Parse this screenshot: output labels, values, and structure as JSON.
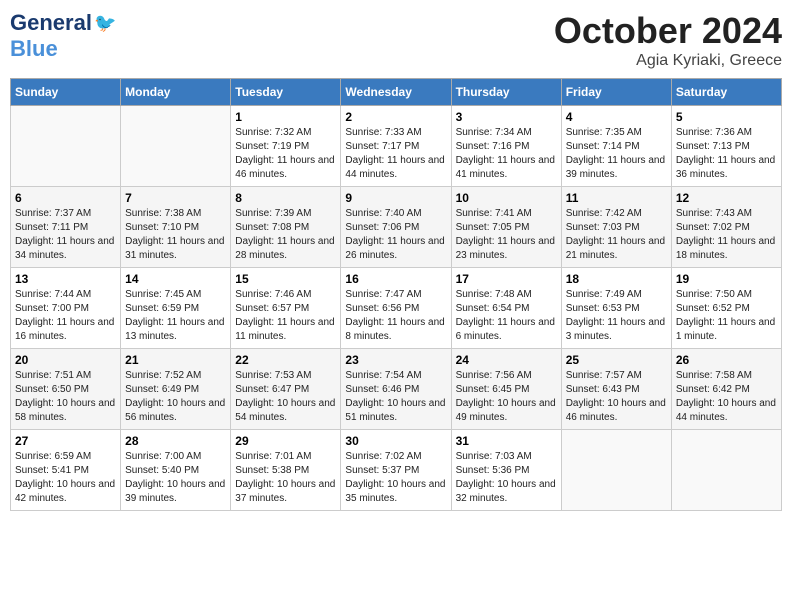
{
  "header": {
    "logo_general": "General",
    "logo_blue": "Blue",
    "month": "October 2024",
    "location": "Agia Kyriaki, Greece"
  },
  "days_of_week": [
    "Sunday",
    "Monday",
    "Tuesday",
    "Wednesday",
    "Thursday",
    "Friday",
    "Saturday"
  ],
  "weeks": [
    [
      {
        "day": "",
        "info": ""
      },
      {
        "day": "",
        "info": ""
      },
      {
        "day": "1",
        "info": "Sunrise: 7:32 AM\nSunset: 7:19 PM\nDaylight: 11 hours and 46 minutes."
      },
      {
        "day": "2",
        "info": "Sunrise: 7:33 AM\nSunset: 7:17 PM\nDaylight: 11 hours and 44 minutes."
      },
      {
        "day": "3",
        "info": "Sunrise: 7:34 AM\nSunset: 7:16 PM\nDaylight: 11 hours and 41 minutes."
      },
      {
        "day": "4",
        "info": "Sunrise: 7:35 AM\nSunset: 7:14 PM\nDaylight: 11 hours and 39 minutes."
      },
      {
        "day": "5",
        "info": "Sunrise: 7:36 AM\nSunset: 7:13 PM\nDaylight: 11 hours and 36 minutes."
      }
    ],
    [
      {
        "day": "6",
        "info": "Sunrise: 7:37 AM\nSunset: 7:11 PM\nDaylight: 11 hours and 34 minutes."
      },
      {
        "day": "7",
        "info": "Sunrise: 7:38 AM\nSunset: 7:10 PM\nDaylight: 11 hours and 31 minutes."
      },
      {
        "day": "8",
        "info": "Sunrise: 7:39 AM\nSunset: 7:08 PM\nDaylight: 11 hours and 28 minutes."
      },
      {
        "day": "9",
        "info": "Sunrise: 7:40 AM\nSunset: 7:06 PM\nDaylight: 11 hours and 26 minutes."
      },
      {
        "day": "10",
        "info": "Sunrise: 7:41 AM\nSunset: 7:05 PM\nDaylight: 11 hours and 23 minutes."
      },
      {
        "day": "11",
        "info": "Sunrise: 7:42 AM\nSunset: 7:03 PM\nDaylight: 11 hours and 21 minutes."
      },
      {
        "day": "12",
        "info": "Sunrise: 7:43 AM\nSunset: 7:02 PM\nDaylight: 11 hours and 18 minutes."
      }
    ],
    [
      {
        "day": "13",
        "info": "Sunrise: 7:44 AM\nSunset: 7:00 PM\nDaylight: 11 hours and 16 minutes."
      },
      {
        "day": "14",
        "info": "Sunrise: 7:45 AM\nSunset: 6:59 PM\nDaylight: 11 hours and 13 minutes."
      },
      {
        "day": "15",
        "info": "Sunrise: 7:46 AM\nSunset: 6:57 PM\nDaylight: 11 hours and 11 minutes."
      },
      {
        "day": "16",
        "info": "Sunrise: 7:47 AM\nSunset: 6:56 PM\nDaylight: 11 hours and 8 minutes."
      },
      {
        "day": "17",
        "info": "Sunrise: 7:48 AM\nSunset: 6:54 PM\nDaylight: 11 hours and 6 minutes."
      },
      {
        "day": "18",
        "info": "Sunrise: 7:49 AM\nSunset: 6:53 PM\nDaylight: 11 hours and 3 minutes."
      },
      {
        "day": "19",
        "info": "Sunrise: 7:50 AM\nSunset: 6:52 PM\nDaylight: 11 hours and 1 minute."
      }
    ],
    [
      {
        "day": "20",
        "info": "Sunrise: 7:51 AM\nSunset: 6:50 PM\nDaylight: 10 hours and 58 minutes."
      },
      {
        "day": "21",
        "info": "Sunrise: 7:52 AM\nSunset: 6:49 PM\nDaylight: 10 hours and 56 minutes."
      },
      {
        "day": "22",
        "info": "Sunrise: 7:53 AM\nSunset: 6:47 PM\nDaylight: 10 hours and 54 minutes."
      },
      {
        "day": "23",
        "info": "Sunrise: 7:54 AM\nSunset: 6:46 PM\nDaylight: 10 hours and 51 minutes."
      },
      {
        "day": "24",
        "info": "Sunrise: 7:56 AM\nSunset: 6:45 PM\nDaylight: 10 hours and 49 minutes."
      },
      {
        "day": "25",
        "info": "Sunrise: 7:57 AM\nSunset: 6:43 PM\nDaylight: 10 hours and 46 minutes."
      },
      {
        "day": "26",
        "info": "Sunrise: 7:58 AM\nSunset: 6:42 PM\nDaylight: 10 hours and 44 minutes."
      }
    ],
    [
      {
        "day": "27",
        "info": "Sunrise: 6:59 AM\nSunset: 5:41 PM\nDaylight: 10 hours and 42 minutes."
      },
      {
        "day": "28",
        "info": "Sunrise: 7:00 AM\nSunset: 5:40 PM\nDaylight: 10 hours and 39 minutes."
      },
      {
        "day": "29",
        "info": "Sunrise: 7:01 AM\nSunset: 5:38 PM\nDaylight: 10 hours and 37 minutes."
      },
      {
        "day": "30",
        "info": "Sunrise: 7:02 AM\nSunset: 5:37 PM\nDaylight: 10 hours and 35 minutes."
      },
      {
        "day": "31",
        "info": "Sunrise: 7:03 AM\nSunset: 5:36 PM\nDaylight: 10 hours and 32 minutes."
      },
      {
        "day": "",
        "info": ""
      },
      {
        "day": "",
        "info": ""
      }
    ]
  ]
}
